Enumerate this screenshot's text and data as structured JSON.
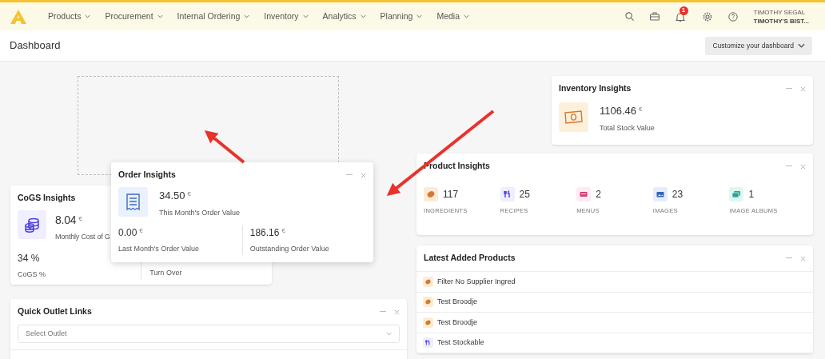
{
  "nav": {
    "items": [
      {
        "label": "Products"
      },
      {
        "label": "Procurement"
      },
      {
        "label": "Internal Ordering"
      },
      {
        "label": "Inventory"
      },
      {
        "label": "Analytics"
      },
      {
        "label": "Planning"
      },
      {
        "label": "Media"
      }
    ],
    "notification_count": "1",
    "user": {
      "name": "TIMOTHY SEGAL",
      "business": "TIMOTHY'S BIST..."
    }
  },
  "page": {
    "title": "Dashboard",
    "customize_button": "Customize your dashboard"
  },
  "cogs_insights": {
    "title": "CoGS Insights",
    "main": {
      "value": "8.04",
      "unit": "€",
      "label": "Monthly Cost of G"
    },
    "stats": [
      {
        "value": "34 %",
        "label": "CoGS %"
      },
      {
        "label": "Turn Over"
      }
    ]
  },
  "quick_outlet_links": {
    "title": "Quick Outlet Links",
    "select": {
      "placeholder": "Select Outlet"
    }
  },
  "order_insights": {
    "title": "Order Insights",
    "dragging": true,
    "main": {
      "value": "34.50",
      "unit": "€",
      "label": "This Month's Order Value"
    },
    "stats": [
      {
        "value": "0.00",
        "unit": "€",
        "label": "Last Month's Order Value"
      },
      {
        "value": "186.16",
        "unit": "€",
        "label": "Outstanding Order Value"
      }
    ]
  },
  "inventory_insights": {
    "title": "Inventory Insights",
    "main": {
      "value": "1106.46",
      "unit": "€",
      "label": "Total Stock Value"
    }
  },
  "product_insights": {
    "title": "Product Insights",
    "stats": [
      {
        "kind": "ingredient",
        "count": "117",
        "label": "INGREDIENTS"
      },
      {
        "kind": "recipe",
        "count": "25",
        "label": "RECIPES"
      },
      {
        "kind": "menu",
        "count": "2",
        "label": "MENUS"
      },
      {
        "kind": "image",
        "count": "23",
        "label": "IMAGES"
      },
      {
        "kind": "album",
        "count": "1",
        "label": "IMAGE ALBUMS"
      }
    ]
  },
  "latest_added_products": {
    "title": "Latest Added Products",
    "items": [
      {
        "kind": "ingredient",
        "name": "Filter No Supplier Ingred"
      },
      {
        "kind": "ingredient",
        "name": "Test Broodje"
      },
      {
        "kind": "ingredient",
        "name": "Test Broodje"
      },
      {
        "kind": "recipe",
        "name": "Test Stockable"
      }
    ]
  }
}
